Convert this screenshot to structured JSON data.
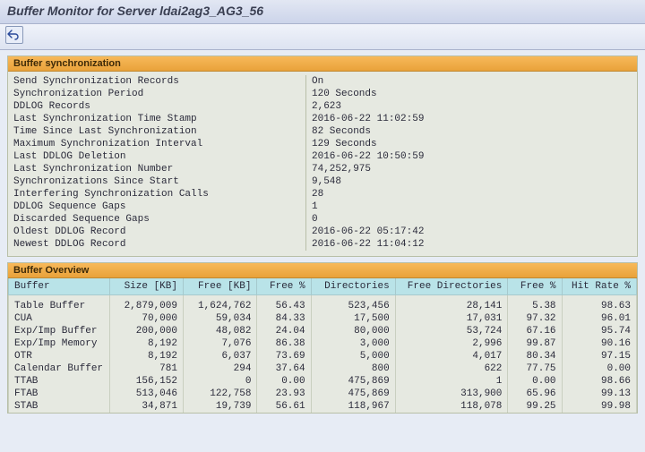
{
  "title": "Buffer Monitor for Server ldai2ag3_AG3_56",
  "panels": {
    "sync": {
      "header": "Buffer synchronization",
      "rows": [
        {
          "label": "Send Synchronization Records",
          "value": "On"
        },
        {
          "label": "Synchronization Period",
          "value": "120 Seconds"
        },
        {
          "label": "DDLOG Records",
          "value": "2,623"
        },
        {
          "label": "Last Synchronization Time Stamp",
          "value": "2016-06-22 11:02:59"
        },
        {
          "label": "Time Since Last Synchronization",
          "value": "82 Seconds"
        },
        {
          "label": "Maximum Synchronization Interval",
          "value": "129 Seconds"
        },
        {
          "label": "Last DDLOG Deletion",
          "value": "2016-06-22 10:50:59"
        },
        {
          "label": "Last Synchronization Number",
          "value": "74,252,975"
        },
        {
          "label": "Synchronizations Since Start",
          "value": "9,548"
        },
        {
          "label": "Interfering Synchronization Calls",
          "value": "28"
        },
        {
          "label": "DDLOG Sequence Gaps",
          "value": "1"
        },
        {
          "label": "Discarded Sequence Gaps",
          "value": "0"
        },
        {
          "label": "Oldest DDLOG Record",
          "value": "2016-06-22 05:17:42"
        },
        {
          "label": "Newest DDLOG Record",
          "value": "2016-06-22 11:04:12"
        }
      ]
    },
    "overview": {
      "header": "Buffer Overview",
      "columns": [
        "Buffer",
        "Size [KB]",
        "Free [KB]",
        "Free %",
        "Directories",
        "Free Directories",
        "Free %",
        "Hit Rate %"
      ],
      "rows": [
        {
          "name": "Table Buffer",
          "size": "2,879,009",
          "free": "1,624,762",
          "fpct": "56.43",
          "dir": "523,456",
          "fdir": "28,141",
          "fpct2": "5.38",
          "hit": "98.63"
        },
        {
          "name": "CUA",
          "size": "70,000",
          "free": "59,034",
          "fpct": "84.33",
          "dir": "17,500",
          "fdir": "17,031",
          "fpct2": "97.32",
          "hit": "96.01"
        },
        {
          "name": "Exp/Imp Buffer",
          "size": "200,000",
          "free": "48,082",
          "fpct": "24.04",
          "dir": "80,000",
          "fdir": "53,724",
          "fpct2": "67.16",
          "hit": "95.74"
        },
        {
          "name": "Exp/Imp Memory",
          "size": "8,192",
          "free": "7,076",
          "fpct": "86.38",
          "dir": "3,000",
          "fdir": "2,996",
          "fpct2": "99.87",
          "hit": "90.16"
        },
        {
          "name": "OTR",
          "size": "8,192",
          "free": "6,037",
          "fpct": "73.69",
          "dir": "5,000",
          "fdir": "4,017",
          "fpct2": "80.34",
          "hit": "97.15"
        },
        {
          "name": "Calendar Buffer",
          "size": "781",
          "free": "294",
          "fpct": "37.64",
          "dir": "800",
          "fdir": "622",
          "fpct2": "77.75",
          "hit": "0.00"
        },
        {
          "name": "TTAB",
          "size": "156,152",
          "free": "0",
          "fpct": "0.00",
          "dir": "475,869",
          "fdir": "1",
          "fpct2": "0.00",
          "hit": "98.66"
        },
        {
          "name": "FTAB",
          "size": "513,046",
          "free": "122,758",
          "fpct": "23.93",
          "dir": "475,869",
          "fdir": "313,900",
          "fpct2": "65.96",
          "hit": "99.13"
        },
        {
          "name": "STAB",
          "size": "34,871",
          "free": "19,739",
          "fpct": "56.61",
          "dir": "118,967",
          "fdir": "118,078",
          "fpct2": "99.25",
          "hit": "99.98"
        }
      ]
    }
  }
}
